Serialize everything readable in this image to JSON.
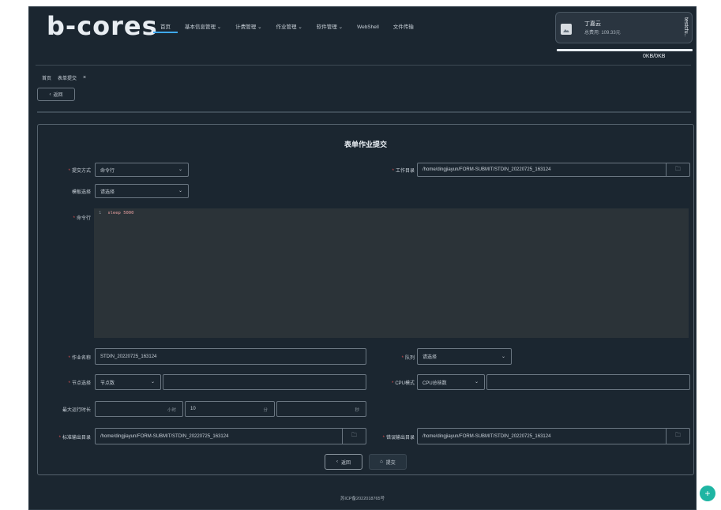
{
  "app": {
    "logo": "b-cores"
  },
  "nav": [
    {
      "label": "首页",
      "active": true
    },
    {
      "label": "基本信息管理 ⌄",
      "active": false
    },
    {
      "label": "计费管理 ⌄",
      "active": false
    },
    {
      "label": "作业管理 ⌄",
      "active": false
    },
    {
      "label": "软件管理 ⌄",
      "active": false
    },
    {
      "label": "WebShell",
      "active": false
    },
    {
      "label": "文件传输",
      "active": false
    }
  ],
  "user": {
    "name": "丁嘉云",
    "fee": "总费用: 109.33元",
    "side": "testcfu.."
  },
  "quota": "0KB/0KB",
  "breadcrumb": {
    "home": "首页",
    "current": "表单提交",
    "close": "×"
  },
  "back_button": {
    "icon": "‹",
    "label": "返回"
  },
  "form": {
    "title": "表单作业提交",
    "submit_mode": {
      "label": "提交方式",
      "value": "命令行"
    },
    "work_dir": {
      "label": "工作目录",
      "value": "/home/dingjiayun/FORM-SUBMIT/STDIN_20220725_163124"
    },
    "template": {
      "label": "模板选择",
      "value": "请选择"
    },
    "command": {
      "label": "命令行",
      "line_no": "1",
      "code_kw": "sleep",
      "code_arg": "5000"
    },
    "job_name": {
      "label": "作业名称",
      "value": "STDIN_20220725_163124"
    },
    "queue": {
      "label": "队列",
      "value": "请选择"
    },
    "node": {
      "label": "节点选择",
      "value": "节点数"
    },
    "cpu_mode": {
      "label": "CPU模式",
      "value": "CPU总核数"
    },
    "max_runtime": {
      "label": "最大运行时长",
      "hours_unit": "小时",
      "minutes": "10",
      "minutes_unit": "分",
      "seconds_unit": "秒"
    },
    "stdout_dir": {
      "label": "标准输出目录",
      "value": "/home/dingjiayun/FORM-SUBMIT/STDIN_20220725_163124"
    },
    "stderr_dir": {
      "label": "错误输出目录",
      "value": "/home/dingjiayun/FORM-SUBMIT/STDIN_20220725_163124"
    },
    "back_label": "返回",
    "submit_label": "提交"
  },
  "footer": "苏ICP备2022018765号",
  "colors": {
    "background": "#1b2630",
    "accent": "#3fa9f5",
    "required": "#e05252",
    "fab": "#1fb5a3"
  }
}
